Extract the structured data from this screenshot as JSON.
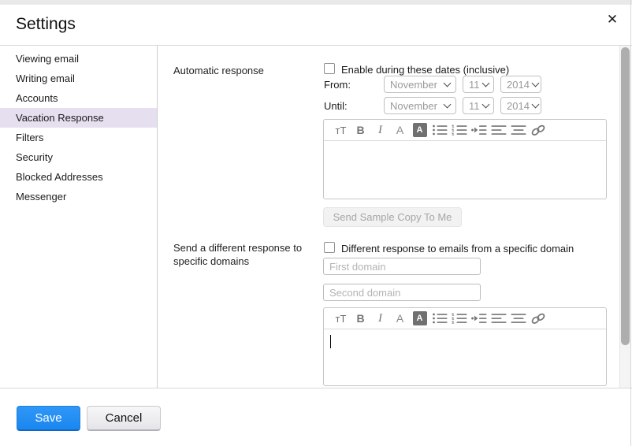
{
  "page": {
    "title": "Settings"
  },
  "icons": {
    "close": "✕",
    "font_size": "тT",
    "bold": "B",
    "italic": "I",
    "font_color": "A",
    "highlight_color": "A"
  },
  "sidebar": {
    "items": [
      {
        "label": "Viewing email"
      },
      {
        "label": "Writing email"
      },
      {
        "label": "Accounts"
      },
      {
        "label": "Vacation Response",
        "selected": true
      },
      {
        "label": "Filters"
      },
      {
        "label": "Security"
      },
      {
        "label": "Blocked Addresses"
      },
      {
        "label": "Messenger"
      }
    ]
  },
  "automatic_response": {
    "label": "Automatic response",
    "enable_checkbox_label": "Enable during these dates (inclusive)",
    "from_label": "From:",
    "until_label": "Until:",
    "from": {
      "month": "November",
      "day": "11",
      "year": "2014"
    },
    "until": {
      "month": "November",
      "day": "11",
      "year": "2014"
    },
    "sample_button_label": "Send Sample Copy To Me"
  },
  "specific_domains": {
    "label": "Send a different response to specific domains",
    "checkbox_label": "Different response to emails from a specific domain",
    "first_domain_placeholder": "First domain",
    "second_domain_placeholder": "Second domain"
  },
  "footer": {
    "save_label": "Save",
    "cancel_label": "Cancel"
  },
  "colors": {
    "accent_blue": "#1e87f0",
    "selected_item_bg": "#e6dff0"
  }
}
